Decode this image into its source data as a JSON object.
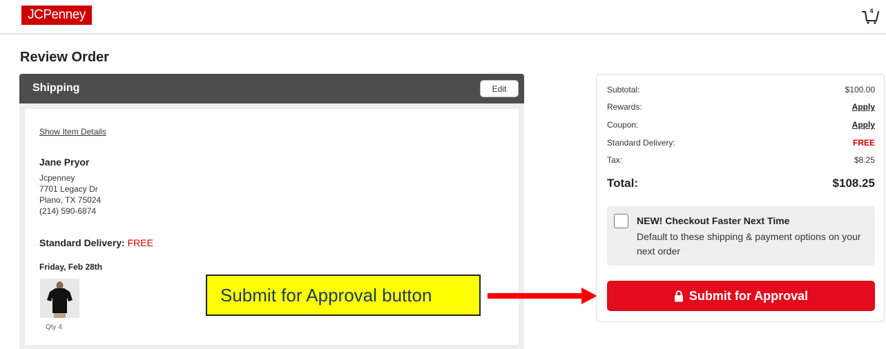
{
  "header": {
    "logo_text": "JCPenney",
    "cart_count": "4"
  },
  "page": {
    "title": "Review Order"
  },
  "shipping": {
    "title": "Shipping",
    "edit_label": "Edit",
    "show_item_details": "Show Item Details",
    "name": "Jane Pryor",
    "address_lines": [
      "Jcpenney",
      "7701 Legacy Dr",
      "Plano, TX 75024",
      "(214) 590-6874"
    ],
    "delivery_label": "Standard Delivery:",
    "delivery_value": "FREE",
    "delivery_date": "Friday, Feb 28th",
    "item_qty": "Qty 4",
    "item_icon": "black-tshirt-image"
  },
  "summary": {
    "subtotal_label": "Subtotal:",
    "subtotal_value": "$100.00",
    "rewards_label": "Rewards:",
    "rewards_value": "Apply",
    "coupon_label": "Coupon:",
    "coupon_value": "Apply",
    "standard_delivery_label": "Standard Delivery:",
    "standard_delivery_value": "FREE",
    "tax_label": "Tax:",
    "tax_value": "$8.25",
    "total_label": "Total:",
    "total_value": "$108.25",
    "checkout_faster_title": "NEW! Checkout Faster Next Time",
    "checkout_faster_desc": "Default to these shipping & payment options on your next order",
    "submit_label": "Submit for Approval",
    "submit_icon": "lock-icon"
  },
  "annotation": {
    "callout_text": "Submit for Approval button"
  },
  "colors": {
    "brand_red": "#cc0000",
    "button_red": "#e30b1c",
    "panel_header": "#4d4d4d",
    "callout_yellow": "#ffff00",
    "callout_text": "#1f3864",
    "arrow_red": "#ff0000"
  }
}
